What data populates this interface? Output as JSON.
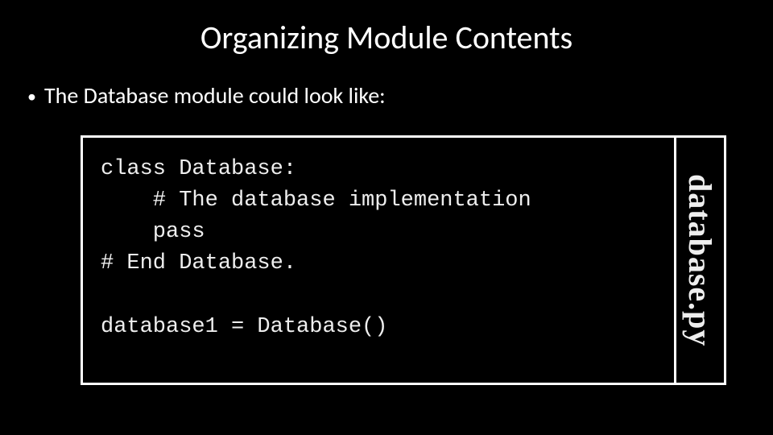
{
  "slide": {
    "title": "Organizing Module Contents",
    "bullet": "The Database module could look like:",
    "code": "class Database:\n    # The database implementation\n    pass\n# End Database.\n\ndatabase1 = Database()",
    "file_label": "database.py"
  }
}
